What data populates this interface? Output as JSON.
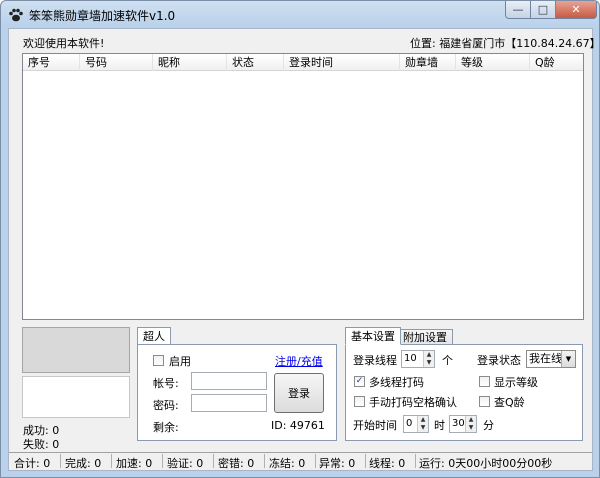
{
  "window": {
    "title": "笨笨熊勋章墙加速软件v1.0",
    "icon": "paw-icon",
    "controls": {
      "minimize": "—",
      "maximize": "□",
      "close": "✕"
    }
  },
  "header": {
    "welcome": "欢迎使用本软件!",
    "location": "位置: 福建省厦门市【110.84.24.67】"
  },
  "listview": {
    "columns": [
      "序号",
      "号码",
      "昵称",
      "状态",
      "登录时间",
      "勋章墙",
      "等级",
      "Q龄"
    ],
    "rows": []
  },
  "stats": {
    "success": "成功: 0",
    "fail": "失败: 0"
  },
  "account_panel": {
    "tab": "超人",
    "enable_label": "启用",
    "enable_checked": false,
    "register_link": "注册/充值",
    "account_label": "帐号:",
    "account_value": "",
    "password_label": "密码:",
    "password_value": "",
    "login_button": "登录",
    "remaining_label": "剩余:",
    "id_label": "ID: 49761"
  },
  "settings_panel": {
    "tabs": [
      "基本设置",
      "附加设置"
    ],
    "active_tab": 0,
    "threads_label": "登录线程",
    "threads_value": "10",
    "threads_unit": "个",
    "login_status_label": "登录状态",
    "login_status_value": "我在线",
    "multi_thread_label": "多线程打码",
    "multi_thread_checked": true,
    "show_level_label": "显示等级",
    "show_level_checked": false,
    "manual_captcha_label": "手动打码空格确认",
    "manual_captcha_checked": false,
    "check_qage_label": "查Q龄",
    "check_qage_checked": false,
    "start_time_label": "开始时间",
    "start_hour": "0",
    "hour_unit": "时",
    "start_minute": "30",
    "minute_unit": "分"
  },
  "statusbar": {
    "items": [
      "合计: 0",
      "完成: 0",
      "加速: 0",
      "验证: 0",
      "密错: 0",
      "冻结: 0",
      "异常: 0",
      "线程: 0",
      "运行: 0天00小时00分00秒"
    ]
  },
  "colors": {
    "titlebar": "#b9d1ea",
    "close_button": "#c75a45",
    "link": "#0000ee",
    "panel_bg": "#f0f0f0"
  }
}
